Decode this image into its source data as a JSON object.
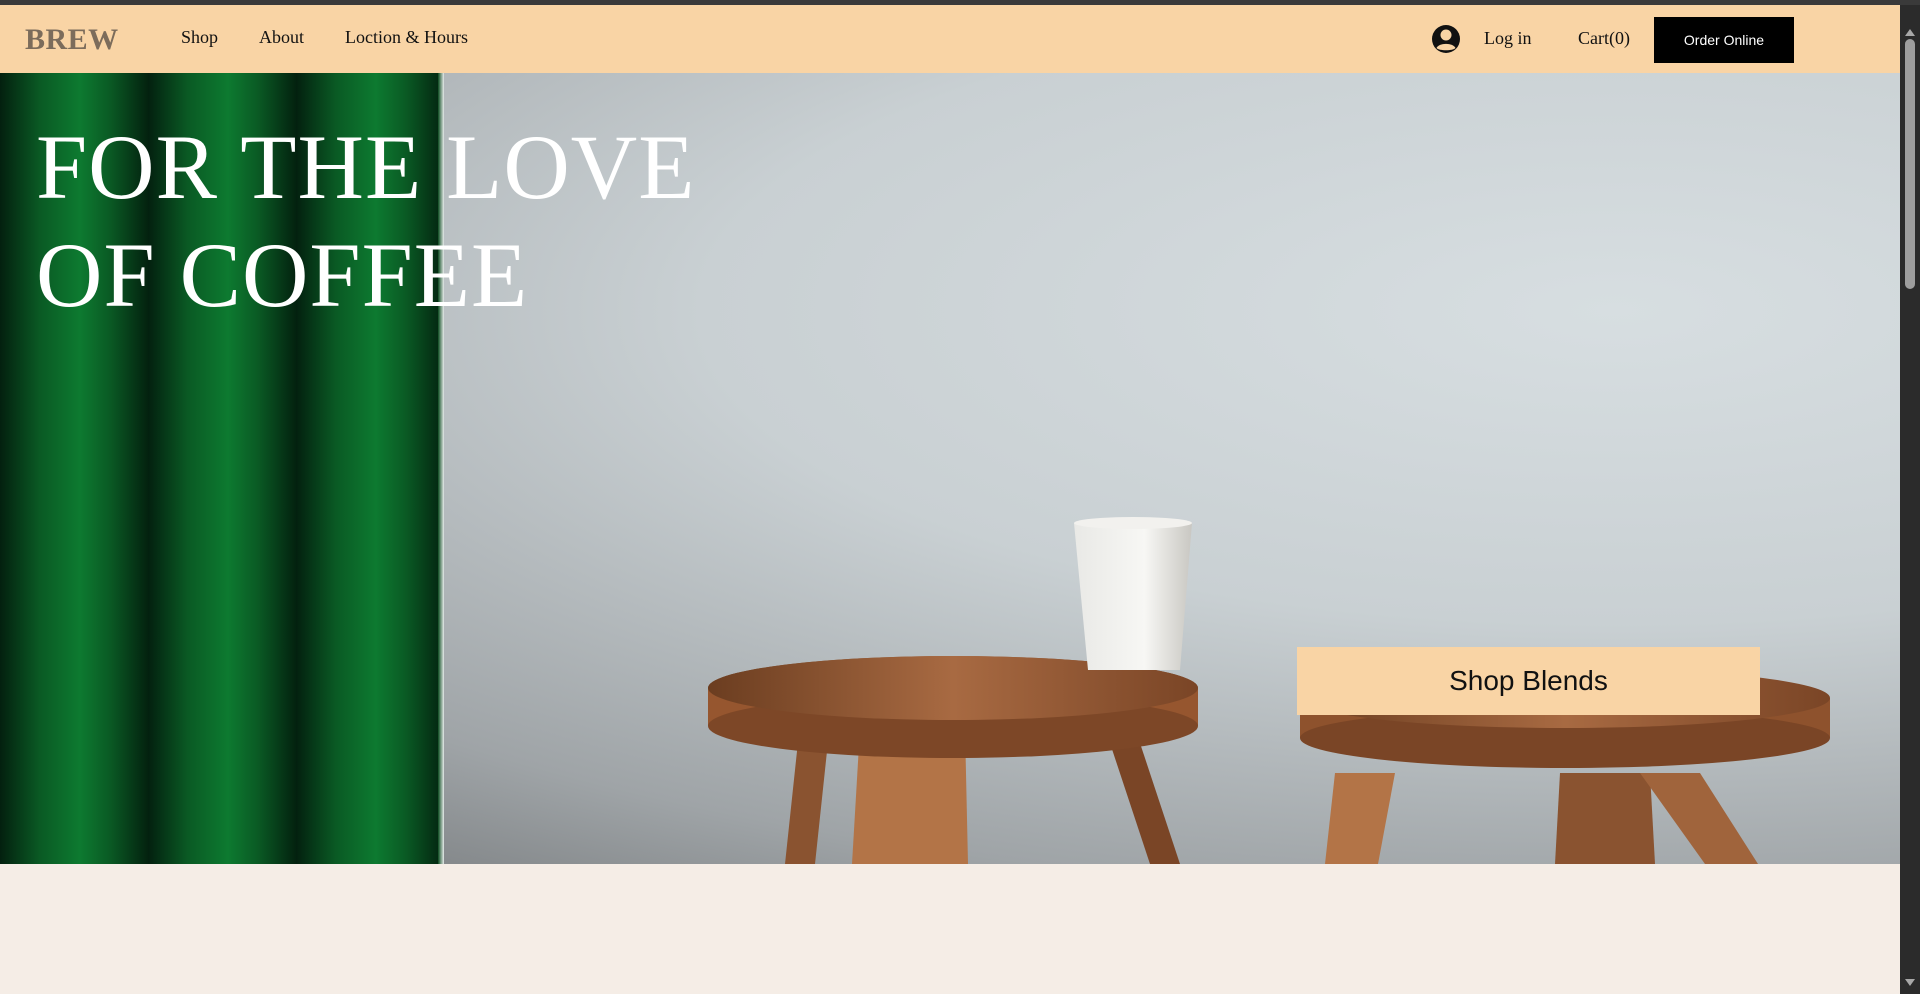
{
  "header": {
    "logo": "BREW",
    "nav": [
      {
        "label": "Shop"
      },
      {
        "label": "About"
      },
      {
        "label": "Loction & Hours"
      }
    ],
    "login_label": "Log in",
    "cart_label": "Cart(0)",
    "order_button": "Order Online",
    "icons": {
      "account": "account-circle-icon"
    }
  },
  "hero": {
    "title_line1": "FOR THE LOVE",
    "title_line2": "OF COFFEE",
    "cta_label": "Shop Blends"
  },
  "colors": {
    "nav_background": "#f9d4a5",
    "cta_background": "#f9d4a5",
    "order_button_background": "#000000",
    "page_background": "#f5ede6",
    "logo_color": "#7c6c5b"
  }
}
